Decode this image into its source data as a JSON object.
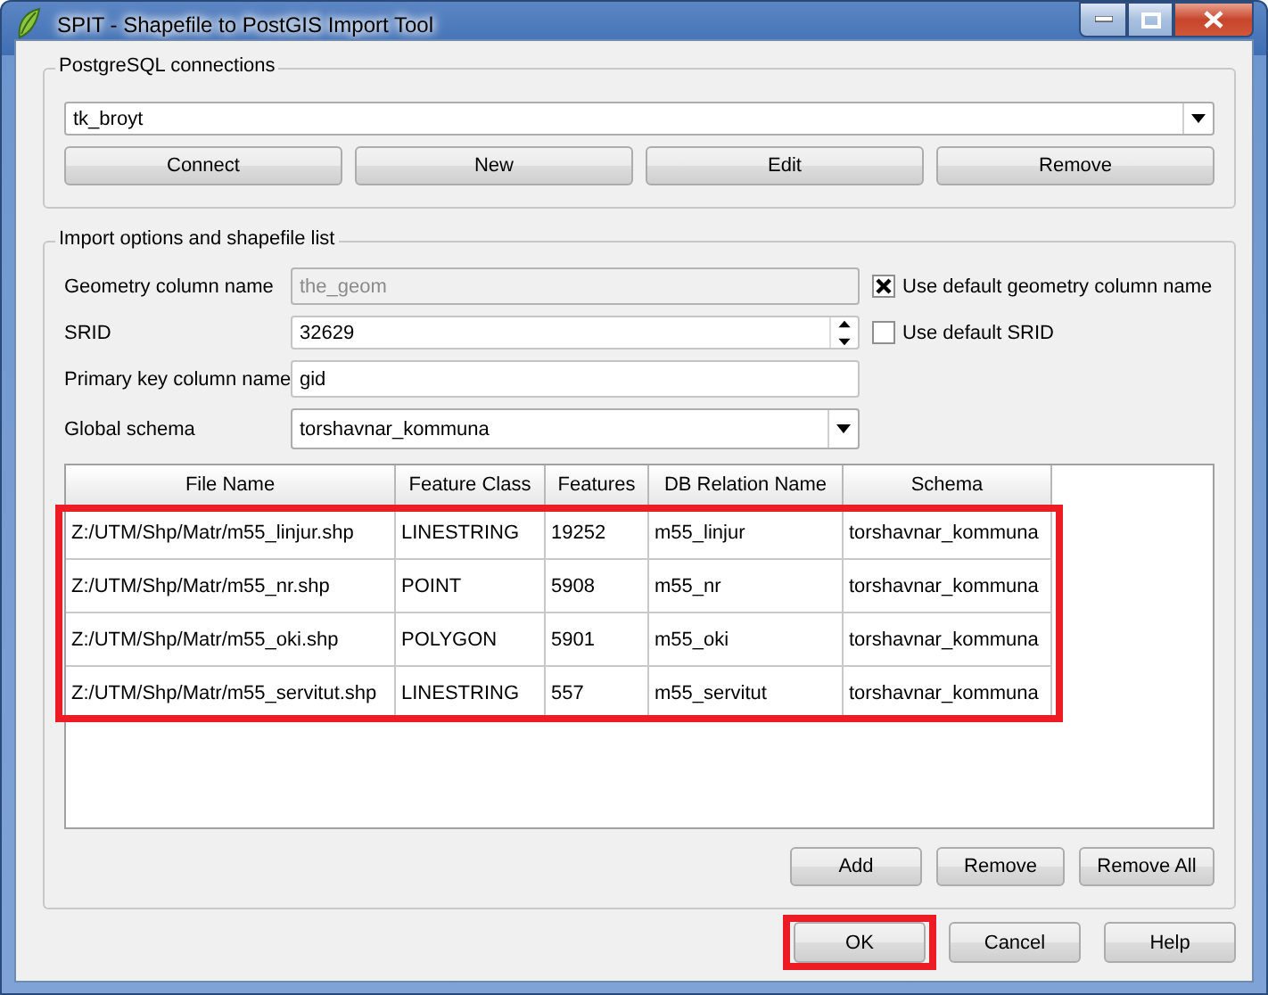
{
  "window": {
    "title": "SPIT - Shapefile to PostGIS Import Tool"
  },
  "connections": {
    "title": "PostgreSQL connections",
    "selected": "tk_broyt",
    "buttons": [
      "Connect",
      "New",
      "Edit",
      "Remove"
    ]
  },
  "import_options": {
    "title": "Import options and shapefile list",
    "fields": [
      {
        "kind": "text",
        "label": "Geometry column name",
        "value": "the_geom",
        "disabled": true,
        "checkbox": {
          "label": "Use default geometry column name",
          "checked": true
        }
      },
      {
        "kind": "spin",
        "label": "SRID",
        "value": "32629",
        "disabled": false,
        "checkbox": {
          "label": "Use default SRID",
          "checked": false
        }
      },
      {
        "kind": "text",
        "label": "Primary key column name",
        "value": "gid",
        "disabled": false
      },
      {
        "kind": "combo",
        "label": "Global schema",
        "value": "torshavnar_kommuna",
        "disabled": false
      }
    ],
    "table": {
      "columns": [
        "File Name",
        "Feature Class",
        "Features",
        "DB Relation Name",
        "Schema"
      ],
      "highlighted": true,
      "rows": [
        [
          "Z:/UTM/Shp/Matr/m55_linjur.shp",
          "LINESTRING",
          "19252",
          "m55_linjur",
          "torshavnar_kommuna"
        ],
        [
          "Z:/UTM/Shp/Matr/m55_nr.shp",
          "POINT",
          "5908",
          "m55_nr",
          "torshavnar_kommuna"
        ],
        [
          "Z:/UTM/Shp/Matr/m55_oki.shp",
          "POLYGON",
          "5901",
          "m55_oki",
          "torshavnar_kommuna"
        ],
        [
          "Z:/UTM/Shp/Matr/m55_servitut.shp",
          "LINESTRING",
          "557",
          "m55_servitut",
          "torshavnar_kommuna"
        ]
      ]
    },
    "list_buttons": [
      "Add",
      "Remove",
      "Remove All"
    ]
  },
  "dialog_buttons": [
    {
      "label": "OK",
      "highlighted": true
    },
    {
      "label": "Cancel",
      "highlighted": false
    },
    {
      "label": "Help",
      "highlighted": false
    }
  ]
}
